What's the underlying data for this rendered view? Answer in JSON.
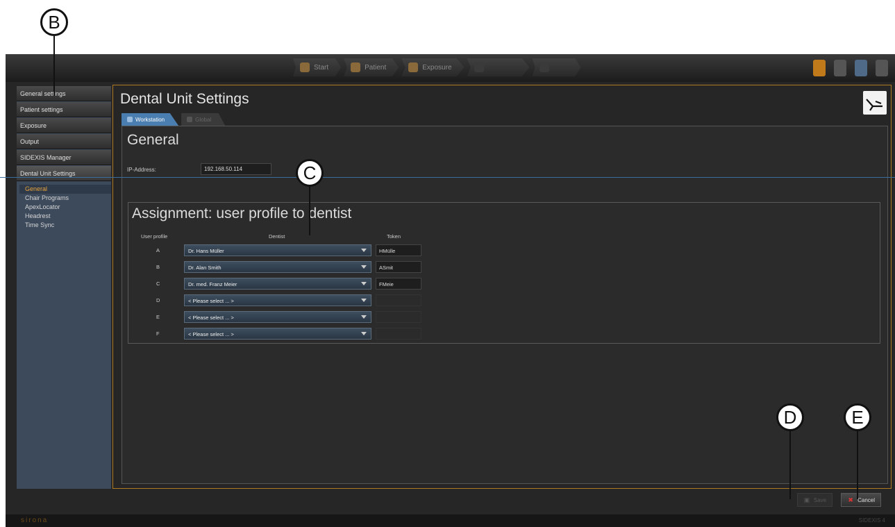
{
  "callouts": {
    "b": "B",
    "c": "C",
    "d": "D",
    "e": "E"
  },
  "workflow": [
    {
      "label": "Start",
      "dim": false
    },
    {
      "label": "Patient",
      "dim": false
    },
    {
      "label": "Exposure",
      "dim": false
    },
    {
      "label": "",
      "dim": true
    },
    {
      "label": "",
      "dim": true
    }
  ],
  "sidebar": {
    "items": [
      {
        "label": "General settings"
      },
      {
        "label": "Patient settings"
      },
      {
        "label": "Exposure"
      },
      {
        "label": "Output"
      },
      {
        "label": "SIDEXIS Manager"
      },
      {
        "label": "Dental Unit Settings"
      }
    ],
    "subitems": [
      {
        "label": "General"
      },
      {
        "label": "Chair Programs"
      },
      {
        "label": "ApexLocator"
      },
      {
        "label": "Headrest"
      },
      {
        "label": "Time Sync"
      }
    ]
  },
  "main": {
    "title": "Dental Unit Settings",
    "tabs": [
      {
        "label": "Workstation"
      },
      {
        "label": "Global"
      }
    ],
    "general_title": "General",
    "ip_label": "IP-Address:",
    "ip_value": "192.168.50.114",
    "assignment": {
      "title": "Assignment: user profile to dentist",
      "col_profile": "User profile",
      "col_dentist": "Dentist",
      "col_token": "Token",
      "rows": [
        {
          "profile": "A",
          "dentist": "Dr. Hans Müller",
          "token": "HMülle"
        },
        {
          "profile": "B",
          "dentist": "Dr. Alan Smith",
          "token": "ASmit"
        },
        {
          "profile": "C",
          "dentist": "Dr. med. Franz Meier",
          "token": "FMeie"
        },
        {
          "profile": "D",
          "dentist": "< Please select ... >",
          "token": ""
        },
        {
          "profile": "E",
          "dentist": "< Please select ... >",
          "token": ""
        },
        {
          "profile": "F",
          "dentist": "< Please select ... >",
          "token": ""
        }
      ]
    }
  },
  "buttons": {
    "save": "Save",
    "cancel": "Cancel"
  },
  "status": {
    "brand": "sirona",
    "version": "SIDEXIS 4"
  },
  "colors": {
    "accent": "#e8a33d",
    "frame": "#b07a22",
    "tab_active": "#4a7eb0"
  }
}
